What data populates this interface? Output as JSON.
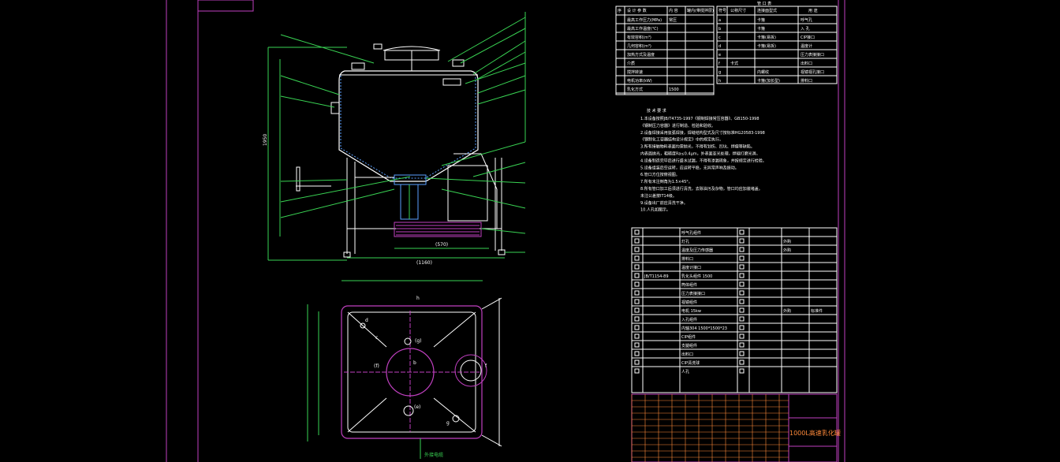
{
  "drawing": {
    "title": "1000L高速乳化罐",
    "colors": {
      "background": "#000000",
      "border": "#c040c0",
      "dimension": "#39d353",
      "outline": "#ffffff",
      "hidden": "#5aa0ff",
      "title_block": "#ff8a3a"
    }
  },
  "front_view": {
    "height_dim": "1950",
    "width_dim": "(1160)",
    "inner_dim": "(570)",
    "leader_count": 17
  },
  "top_view": {
    "labels": [
      "h",
      "d",
      "c",
      "(g)",
      "b",
      "(f)",
      "(e)",
      "g",
      "f"
    ],
    "note": "外接电缆"
  },
  "tech_specs": {
    "header": [
      "序",
      "设 计 参 数",
      "内 容",
      "罐内(带搅拌层)"
    ],
    "rows": [
      "最高工作压力(MPa)",
      "最高工作温度(℃)",
      "有效容积(m³)",
      "几何容积(m³)",
      "加热方式及温度",
      "介质",
      "搅拌转速",
      "电机功率(kW)",
      "乳化方式"
    ],
    "row_values": [
      "常压",
      "",
      "",
      "",
      "",
      "",
      "",
      "",
      "1500"
    ]
  },
  "nozzle_table": {
    "title": "管 口 表",
    "header": [
      "符号",
      "公称尺寸",
      "连接面型式",
      "用 途"
    ],
    "rows": [
      [
        "a",
        "",
        "卡箍",
        "呼气孔"
      ],
      [
        "b",
        "",
        "卡箍",
        "入 孔"
      ],
      [
        "c",
        "",
        "卡箍(易拆)",
        "CIP接口"
      ],
      [
        "d",
        "",
        "卡箍(易拆)",
        "温度计"
      ],
      [
        "e",
        "",
        "",
        "压力表接接口"
      ],
      [
        "f",
        "卡式",
        "",
        "出料口"
      ],
      [
        "g",
        "",
        "内螺纹",
        "视镜视孔接口"
      ],
      [
        "h",
        "",
        "卡箍(加长型)",
        "排料口"
      ]
    ]
  },
  "tech_requirements": {
    "title": "技 术 要 求",
    "lines": [
      "1.本设备按照JB/T4735-1997《钢制焊接常压容器》、GB150-1998",
      "《钢制压力容器》进行制造、检验和验收。",
      "2.设备焊接采用氩弧焊接，焊缝结构型式及尺寸按标准HG20583-1998",
      "《钢制化工容器结构设计规定》中的规定执行。",
      "3.所有接触物料表面均需抛光，不得有划伤、凹坑、焊瘤等缺陷。",
      "内表面抛光，粗糙度Ra≤0.4μm，外表面亚光处理，焊缝打磨光滑。",
      "4.设备制造完毕后进行盛水试漏，不得有渗漏现象，并按规定进行检验。",
      "5.设备组装后空运转，应运转平稳，无异常声响及振动。",
      "6.管口方位按俯视图。",
      "7.所有未注倒角为1.5×45°。",
      "8.所有管口加工后须进行清洗，去除油污及杂物，管口均应加装堵盖。",
      "  未注公差按IT14级。",
      "9.设备出厂前应清洗干净。",
      "10.人孔如图示。"
    ]
  },
  "parts_list": {
    "rows": [
      [
        "",
        "",
        "呼气孔组件",
        "",
        "",
        "",
        ""
      ],
      [
        "",
        "",
        "灯孔",
        "",
        "",
        "外购",
        ""
      ],
      [
        "",
        "",
        "温度及压力传感器",
        "",
        "",
        "外购",
        ""
      ],
      [
        "",
        "",
        "排料口",
        "",
        "",
        "",
        ""
      ],
      [
        "",
        "",
        "温度计接口",
        "",
        "",
        "",
        ""
      ],
      [
        "",
        "JB/T1154-89",
        "乳化头组件 1500",
        "",
        "",
        "",
        ""
      ],
      [
        "",
        "",
        "筒体组件",
        "",
        "",
        "",
        ""
      ],
      [
        "",
        "",
        "压力表接接口",
        "",
        "",
        "",
        ""
      ],
      [
        "",
        "",
        "视镜组件",
        "",
        "",
        "",
        ""
      ],
      [
        "",
        "",
        "电机 15kw",
        "",
        "",
        "外购",
        "标准件"
      ],
      [
        "",
        "",
        "入孔组件",
        "",
        "",
        "",
        ""
      ],
      [
        "",
        "",
        "内轴304 1500*1500*23",
        "",
        "",
        "",
        ""
      ],
      [
        "",
        "",
        "CIP组件",
        "",
        "",
        "",
        ""
      ],
      [
        "",
        "",
        "支腿组件",
        "",
        "",
        "",
        ""
      ],
      [
        "",
        "",
        "出料口",
        "",
        "",
        "",
        ""
      ],
      [
        "",
        "",
        "CIP清洗球",
        "",
        "",
        "",
        ""
      ],
      [
        "",
        "",
        "人孔",
        "",
        "",
        "",
        ""
      ]
    ]
  }
}
